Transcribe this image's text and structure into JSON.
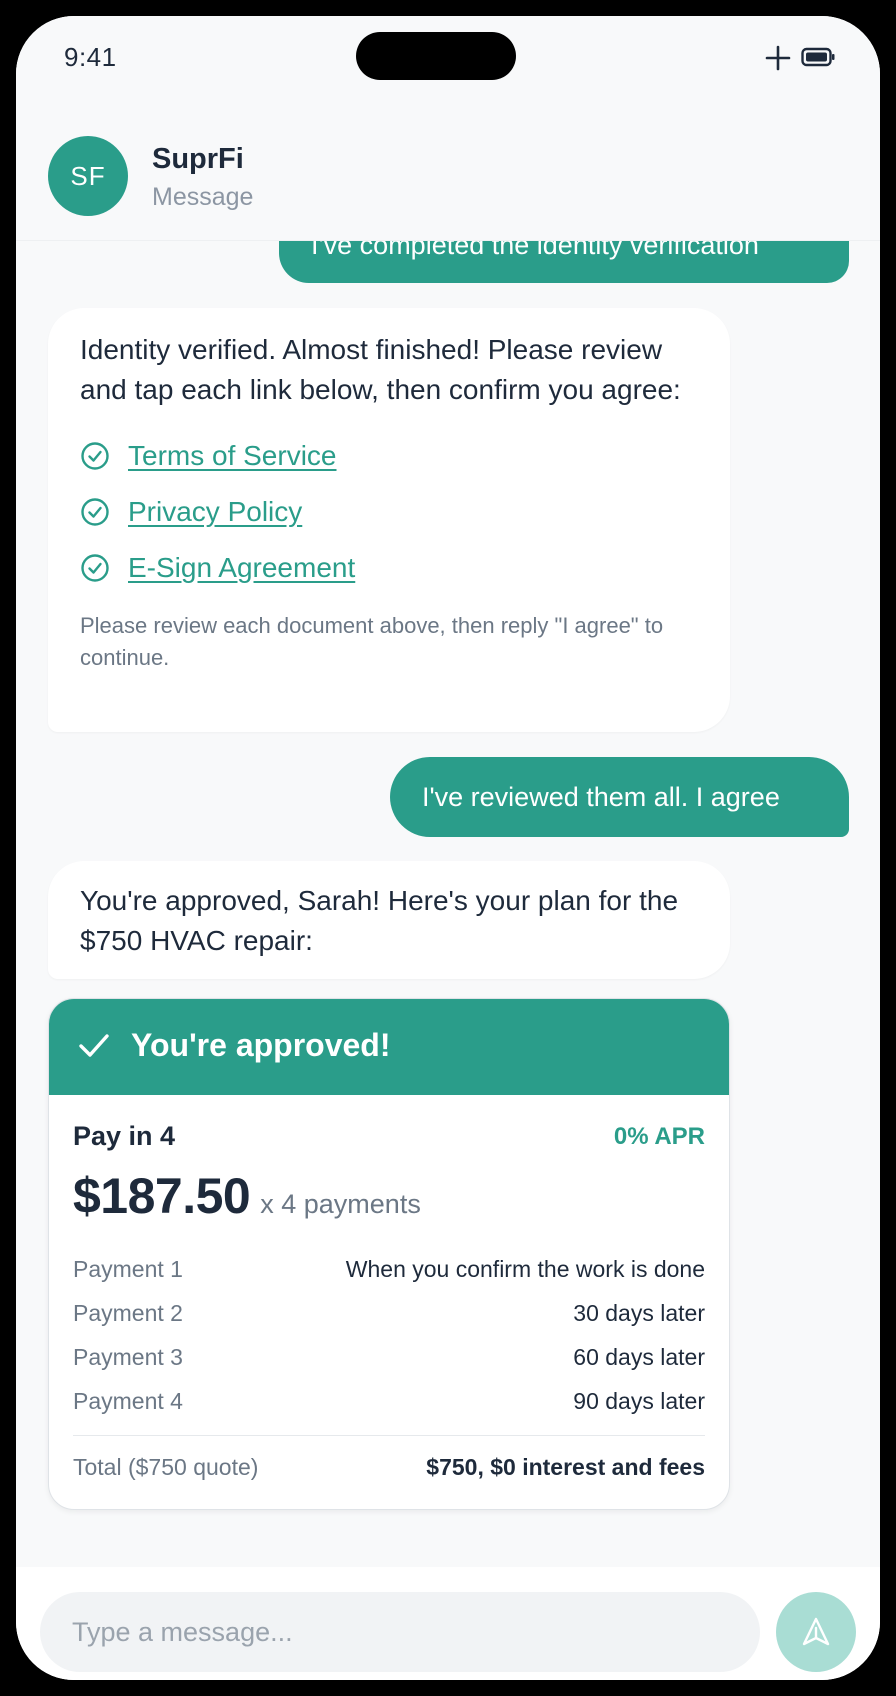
{
  "status_bar": {
    "time": "9:41",
    "icons": [
      "plus-icon",
      "battery-icon"
    ]
  },
  "header": {
    "avatar_initials": "SF",
    "name": "SuprFi",
    "subtitle": "Message"
  },
  "messages": {
    "clipped_outgoing": "I've completed the identity verification",
    "verification": {
      "text": "Identity verified. Almost finished! Please review and tap each link below, then confirm you agree:",
      "documents": [
        {
          "label": "Terms of Service",
          "icon": "check-circle-icon"
        },
        {
          "label": "Privacy Policy",
          "icon": "check-circle-icon"
        },
        {
          "label": "E-Sign Agreement",
          "icon": "check-circle-icon"
        }
      ],
      "note": "Please review each document above, then reply \"I agree\" to continue."
    },
    "agree_reply": "I've reviewed them all. I agree",
    "approval_text": "You're approved, Sarah! Here's your plan for the $750 HVAC repair:"
  },
  "approval_card": {
    "title": "You're approved!",
    "plan_name": "Pay in 4",
    "apr": "0% APR",
    "amount": "$187.50",
    "amount_count": "x 4 payments",
    "schedule": [
      {
        "label": "Payment 1",
        "value": "When you confirm the work is done"
      },
      {
        "label": "Payment 2",
        "value": "30 days later"
      },
      {
        "label": "Payment 3",
        "value": "60 days later"
      },
      {
        "label": "Payment 4",
        "value": "90 days later"
      }
    ],
    "total_label": "Total ($750 quote)",
    "total_value": "$750, $0 interest and fees"
  },
  "composer": {
    "placeholder": "Type a message...",
    "send_icon": "send-icon"
  },
  "colors": {
    "accent": "#2a9d8a",
    "send_button": "#a9ddd4",
    "text_primary": "#1e2a3b",
    "text_secondary": "#6b7785",
    "background": "#f8f9fa"
  }
}
